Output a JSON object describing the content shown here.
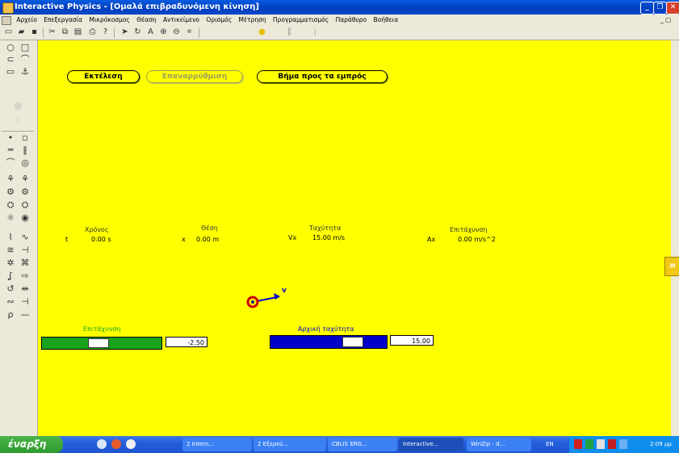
{
  "window": {
    "title": "Interactive Physics - [Ομαλά επιβραδυνόμενη κίνηση]",
    "controls": [
      "_",
      "❐",
      "✕"
    ]
  },
  "menu": [
    "Αρχείο",
    "Επεξεργασία",
    "Μικρόκοσμος",
    "Θέαση",
    "Αντικείμενο",
    "Ορισμός",
    "Μέτρηση",
    "Προγραμματισμός",
    "Παράθυρο",
    "Βοήθεια"
  ],
  "menu_right": "_ ▢",
  "toolbar_icons": [
    "new-file-icon",
    "open-folder-icon",
    "save-icon",
    "cut-icon",
    "copy-icon",
    "paste-icon",
    "print-icon",
    "help-icon",
    "arrow-select-icon",
    "rotate-icon",
    "text-icon",
    "zoom-in-icon",
    "zoom-out-icon",
    "zoom-fit-icon",
    "run-icon",
    "pause-icon",
    "rewind-icon"
  ],
  "controls": {
    "run": "Εκτέλεση",
    "reset": "Επαναρρύθμιση",
    "step": "Βήμα προς τα εμπρός"
  },
  "meters": [
    {
      "title": "Χρόνος",
      "symbol": "t",
      "value": "0.00 s"
    },
    {
      "title": "Θέση",
      "symbol": "x",
      "value": "0.00 m"
    },
    {
      "title": "Ταχύτητα",
      "symbol": "Vx",
      "value": "15.00 m/s"
    },
    {
      "title": "Επιτάχυνση",
      "symbol": "Ax",
      "value": "0.00 m/s^2"
    }
  ],
  "vector_label": "v",
  "sliders": [
    {
      "label": "Επιτάχυνση",
      "value": "-2.50",
      "fraction": 0.47,
      "color": "#1aa31a"
    },
    {
      "label": "Αρχική ταχύτητα",
      "value": "15.00",
      "fraction": 0.75,
      "color": "#0000c8"
    }
  ],
  "taskbar": {
    "start": "έναρξη",
    "tasks": [
      "2 Intern...",
      "2 Εξερεύ...",
      "CBLIS ERG...",
      "Interactive...",
      "WinZip - d..."
    ],
    "lang": "EN",
    "clock": "2:09 μμ"
  },
  "colors": {
    "workspace": "#ffff00",
    "accel": "#1aa31a",
    "velocity": "#0000c8",
    "ball": "#cc0000"
  }
}
